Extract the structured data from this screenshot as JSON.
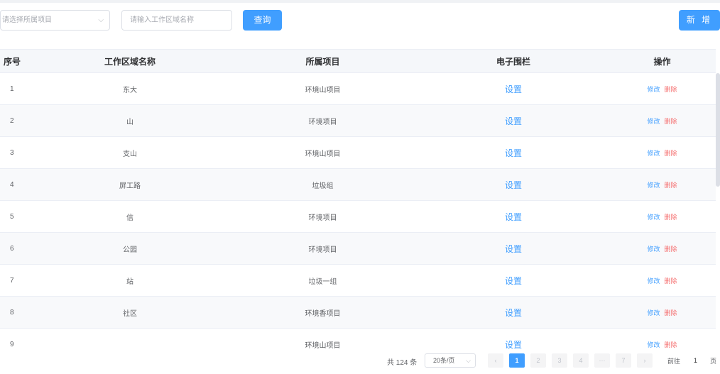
{
  "toolbar": {
    "project_select_placeholder": "请选择所属项目",
    "area_name_placeholder": "请输入工作区域名称",
    "query_label": "查询",
    "add_label": "新 增"
  },
  "table": {
    "headers": [
      "序号",
      "工作区域名称",
      "所属项目",
      "电子围栏",
      "操作"
    ],
    "rows": [
      {
        "index": "1",
        "name": "东大",
        "project": "环境山项目",
        "fence": "设置",
        "edit": "修改",
        "delete": "删除"
      },
      {
        "index": "2",
        "name": "山",
        "project": "环境项目",
        "fence": "设置",
        "edit": "修改",
        "delete": "删除"
      },
      {
        "index": "3",
        "name": "支山",
        "project": "环境山项目",
        "fence": "设置",
        "edit": "修改",
        "delete": "删除"
      },
      {
        "index": "4",
        "name": "屏工路",
        "project": "垃圾组",
        "fence": "设置",
        "edit": "修改",
        "delete": "删除"
      },
      {
        "index": "5",
        "name": "信",
        "project": "环境项目",
        "fence": "设置",
        "edit": "修改",
        "delete": "删除"
      },
      {
        "index": "6",
        "name": "公园",
        "project": "环境项目",
        "fence": "设置",
        "edit": "修改",
        "delete": "删除"
      },
      {
        "index": "7",
        "name": "站",
        "project": "垃圾一组",
        "fence": "设置",
        "edit": "修改",
        "delete": "删除"
      },
      {
        "index": "8",
        "name": "社区",
        "project": "环境香项目",
        "fence": "设置",
        "edit": "修改",
        "delete": "删除"
      },
      {
        "index": "9",
        "name": "",
        "project": "环境山项目",
        "fence": "设置",
        "edit": "修改",
        "delete": "删除"
      }
    ]
  },
  "pagination": {
    "total": "共 124 条",
    "page_size": "20条/页",
    "prev": "‹",
    "pages": [
      "1",
      "2",
      "3",
      "4",
      "···",
      "7"
    ],
    "next": "›",
    "goto_label": "前往",
    "goto_value": "1",
    "page_suffix": "页"
  }
}
